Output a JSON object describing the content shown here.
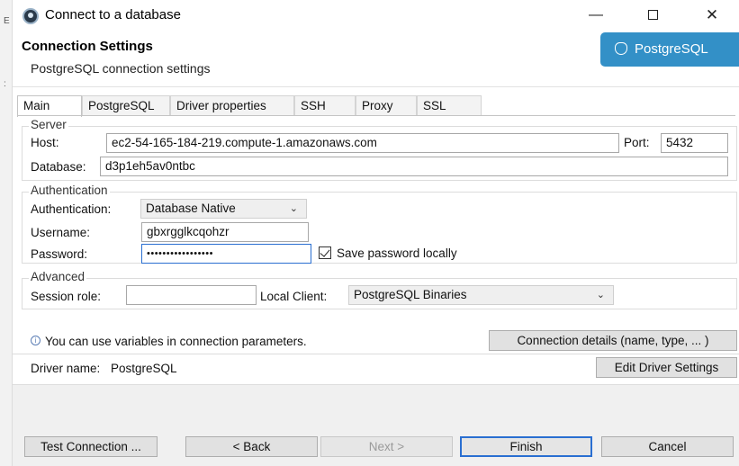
{
  "window": {
    "title": "Connect to a database",
    "controls": {
      "minimize": "—",
      "close": "✕"
    }
  },
  "header": {
    "title": "Connection Settings",
    "subtitle": "PostgreSQL connection settings",
    "badge": "PostgreSQL"
  },
  "tabs": [
    "Main",
    "PostgreSQL",
    "Driver properties",
    "SSH",
    "Proxy",
    "SSL"
  ],
  "server": {
    "group_label": "Server",
    "host_label": "Host:",
    "host_value": "ec2-54-165-184-219.compute-1.amazonaws.com",
    "port_label": "Port:",
    "port_value": "5432",
    "database_label": "Database:",
    "database_value": "d3p1eh5av0ntbc"
  },
  "authentication": {
    "group_label": "Authentication",
    "auth_label": "Authentication:",
    "auth_value": "Database Native",
    "username_label": "Username:",
    "username_value": "gbxrgglkcqohzr",
    "password_label": "Password:",
    "password_value": "•••••••••••••••••",
    "save_password_label": "Save password locally",
    "save_password_checked": true
  },
  "advanced": {
    "group_label": "Advanced",
    "session_role_label": "Session role:",
    "session_role_value": "",
    "local_client_label": "Local Client:",
    "local_client_value": "PostgreSQL Binaries"
  },
  "info": {
    "text": "You can use variables in connection parameters.",
    "connection_details_button": "Connection details (name, type, ... )"
  },
  "driver": {
    "label": "Driver name:",
    "value": "PostgreSQL",
    "edit_button": "Edit Driver Settings"
  },
  "footer": {
    "test_connection": "Test Connection ...",
    "back": "< Back",
    "next": "Next >",
    "finish": "Finish",
    "cancel": "Cancel"
  },
  "colors": {
    "accent": "#2a6fd1",
    "badge": "#3390c7"
  }
}
